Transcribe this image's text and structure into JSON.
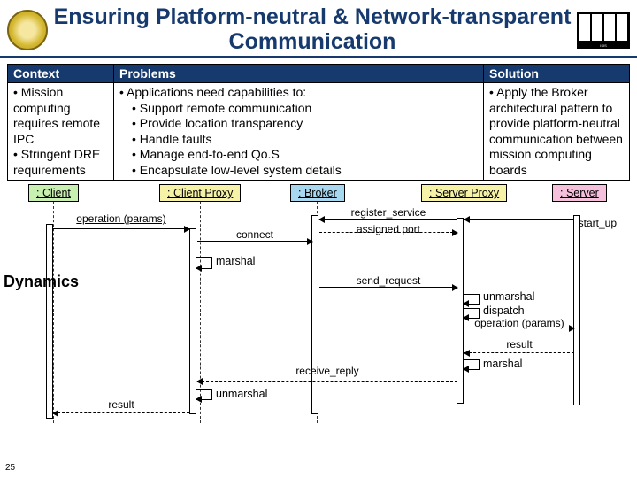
{
  "slide_number": "25",
  "title": "Ensuring Platform-neutral & Network-transparent Communication",
  "table": {
    "headers": {
      "context": "Context",
      "problems": "Problems",
      "solution": "Solution"
    },
    "context": {
      "b1": "Mission computing requires remote IPC",
      "b2": "Stringent DRE requirements"
    },
    "problems": {
      "lead": "Applications need capabilities to:",
      "s1": "Support remote communication",
      "s2": "Provide location transparency",
      "s3": "Handle faults",
      "s4": "Manage end-to-end Qo.S",
      "s5": "Encapsulate low-level system details"
    },
    "solution": {
      "b1": "Apply the Broker architectural pattern to provide platform-neutral communication between mission computing boards"
    }
  },
  "dynamics_label": "Dynamics",
  "lifelines": {
    "client": ": Client",
    "client_proxy": ": Client Proxy",
    "broker": ": Broker",
    "server_proxy": ": Server Proxy",
    "server": ": Server"
  },
  "messages": {
    "operation_params": "operation (params)",
    "connect": "connect",
    "marshal": "marshal",
    "register_service": "register_service",
    "assigned_port": "assigned port",
    "start_up": "start_up",
    "send_request": "send_request",
    "unmarshal": "unmarshal",
    "dispatch": "dispatch",
    "operation_params2": "operation (params)",
    "result": "result",
    "marshal2": "marshal",
    "receive_reply": "receive_reply",
    "unmarshal2": "unmarshal",
    "result2": "result"
  }
}
